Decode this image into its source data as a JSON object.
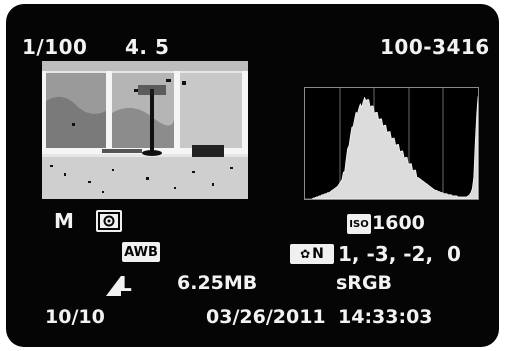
{
  "header": {
    "shutter_speed": "1/100",
    "aperture": "4. 5",
    "file_number": "100-3416"
  },
  "shooting": {
    "mode": "M",
    "metering_icon": "evaluative-metering-icon",
    "white_balance": "AWB",
    "iso_label": "ISO",
    "iso_value": "1600",
    "picture_style_label": "N",
    "picture_style_values": "1, -3, -2,  0"
  },
  "file": {
    "quality": "L",
    "size": "6.25MB",
    "color_space": "sRGB"
  },
  "footer": {
    "frame_counter": "10/10",
    "date": "03/26/2011",
    "time": "14:33:03"
  },
  "histogram": {
    "levels": [
      0,
      0,
      0,
      0,
      0,
      0,
      1,
      1,
      2,
      2,
      3,
      3,
      4,
      4,
      5,
      5,
      6,
      6,
      7,
      8,
      9,
      10,
      11,
      12,
      14,
      16,
      18,
      22,
      28,
      36,
      44,
      52,
      58,
      64,
      70,
      74,
      78,
      82,
      84,
      86,
      88,
      90,
      92,
      94,
      92,
      90,
      88,
      86,
      84,
      82,
      80,
      78,
      76,
      74,
      72,
      70,
      68,
      66,
      64,
      62,
      60,
      58,
      56,
      54,
      52,
      50,
      48,
      46,
      44,
      42,
      40,
      38,
      36,
      34,
      32,
      30,
      28,
      26,
      24,
      22,
      20,
      19,
      18,
      17,
      16,
      15,
      14,
      13,
      12,
      11,
      10,
      9,
      8,
      8,
      7,
      7,
      6,
      6,
      5,
      5,
      5,
      4,
      4,
      4,
      3,
      3,
      3,
      3,
      2,
      2,
      2,
      2,
      2,
      2,
      2,
      3,
      4,
      6,
      10,
      20,
      50,
      80,
      95
    ]
  }
}
